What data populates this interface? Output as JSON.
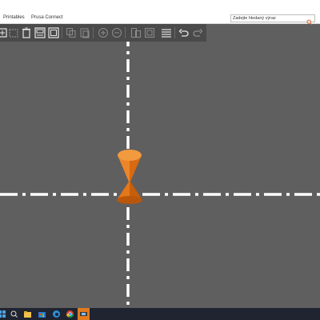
{
  "menubar": {
    "items": [
      "Printables",
      "Prusa Connect"
    ],
    "search_placeholder": "Zadejte hledaný výraz"
  },
  "toolbar": {
    "icons": [
      "add-icon",
      "delete-icon",
      "delete-all-icon",
      "arrange-icon",
      "arrange-selection-icon",
      "copy-icon",
      "paste-icon",
      "add-instance-icon",
      "remove-instance-icon",
      "split-objects-icon",
      "split-parts-icon",
      "layers-editing-icon",
      "undo-icon",
      "redo-icon"
    ]
  },
  "scene": {
    "background": "#5f5f5f",
    "axis_color": "#ffffff",
    "object_color": "#e07010"
  },
  "taskbar": {
    "background": "#1f2430",
    "icons": [
      "start-icon",
      "search-taskbar-icon",
      "file-explorer-icon",
      "store-icon",
      "chrome-icon",
      "prusaslicer-taskbar-icon"
    ]
  }
}
